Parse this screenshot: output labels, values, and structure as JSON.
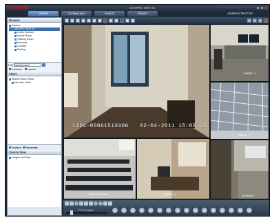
{
  "app": {
    "brand": "Honeywell",
    "window_title": "MAXPRO NVR XE",
    "alert_text": "New events not yet read - click",
    "user": "ADMINISTRATOR"
  },
  "tabs": [
    {
      "label": "Viewer",
      "active": true
    },
    {
      "label": "Configurator",
      "active": false
    },
    {
      "label": "Search",
      "active": false
    },
    {
      "label": "Report",
      "active": false
    }
  ],
  "left": {
    "devices_header": "Devices",
    "tree": [
      {
        "label": "Devices",
        "level": 0,
        "selected": false
      },
      {
        "label": "MAXPRO NVR XE",
        "level": 1,
        "selected": true
      },
      {
        "label": "Lobby Camera",
        "level": 2,
        "selected": false
      },
      {
        "label": "Server Room",
        "level": 2,
        "selected": false
      },
      {
        "label": "Training Room",
        "level": 2,
        "selected": false
      },
      {
        "label": "Entrance",
        "level": 2,
        "selected": false
      },
      {
        "label": "Corridor",
        "level": 2,
        "selected": false
      },
      {
        "label": "Parking",
        "level": 2,
        "selected": false
      }
    ],
    "search_label": "Find",
    "search_value": "Camera name",
    "check_cameras": "Cameras",
    "check_layouts": "Layouts",
    "views_header": "Views",
    "views": [
      {
        "label": "Shared Salvo Views"
      },
      {
        "label": "My salvo views"
      }
    ],
    "bottom_tab_devices": "Devices",
    "bottom_tab_favourites": "Favourites",
    "sources_header": "Source View",
    "sources_item": "Images and Clips"
  },
  "video": {
    "main_overlay": "11D4-000A1510306",
    "main_timestamp": "02-04-2011 15:03:25",
    "small_labels": [
      "CAMERA 2",
      "CAMERA 3",
      "TRAINING ROOM",
      "CAMERA 5",
      "ENTRANCE"
    ]
  },
  "controls": {
    "ptz_label": "PTZ Control"
  },
  "colors": {
    "brand_red": "#d11111",
    "active_tab": "#3f6aa3",
    "chrome_dark": "#1c2b3c"
  }
}
